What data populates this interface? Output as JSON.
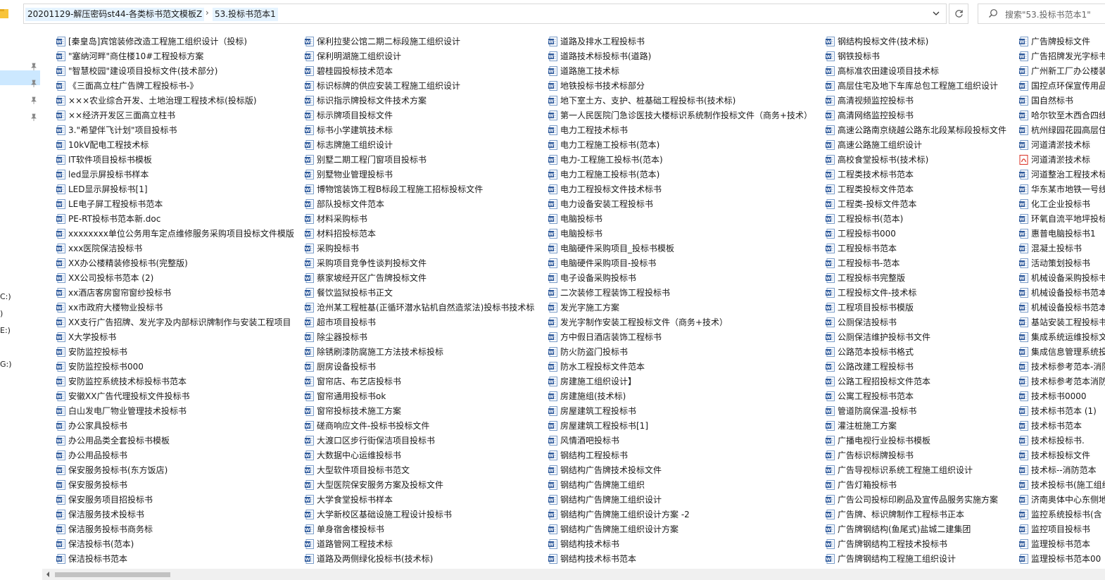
{
  "address": {
    "crumbs": [
      "20201129-解压密码st44-各类标书范文模板Z",
      "53.投标书范本1"
    ],
    "separator": "›"
  },
  "search": {
    "placeholder": "搜索\"53.投标书范本1\""
  },
  "nav": {
    "drives": [
      "C:)",
      ")",
      "E:)",
      "G:)"
    ]
  },
  "icons": {
    "folder": "folder-icon",
    "word": "word-doc-icon",
    "pdf": "pdf-icon",
    "pin": "pin-icon",
    "refresh": "refresh-icon",
    "search": "search-icon",
    "dropdown": "chevron-down-icon"
  },
  "colors": {
    "word": "#2b579a",
    "pdf": "#d93025",
    "selection": "#cce8ff",
    "crumb_bg": "#e5f3ff"
  },
  "files": [
    [
      "[秦皇岛]宾馆装修改造工程施工组织设计（投标)",
      "\"塞纳河畔\"商住楼10#工程投标方案",
      "\"智慧校园\"建设项目投标文件(技术部分)",
      "《三面高立柱广告牌工程投标书-》",
      "×××农业综合开发、土地治理工程技术标(投标版)",
      "××经济开发区三面高立柱书",
      "3.\"希望伴飞计划\"项目投标书",
      "10kV配电工程技术标",
      "IT软件项目投标书模板",
      "led显示屏投标书样本",
      "LED显示屏投标书[1]",
      "LE电子屏工程投标书范本",
      "PE-RT投标书范本新.doc",
      "xxxxxxxx单位公务用车定点维修服务采购项目投标文件模版",
      "xxx医院保洁投标书",
      "XX办公楼精装修投标书(完整版)",
      "XX公司投标书范本 (2)",
      "xx酒店客房窗帘窗纱投标书",
      "xx市政府大楼物业投标书",
      "XX支行广告招牌、发光字及内部标识牌制作与安装工程项目",
      "X大学投标书",
      "安防监控投标书",
      "安防监控投标书000",
      "安防监控系统技术标投标书范本",
      "安徽XX广告代理投标文件投标书",
      "白山发电厂物业管理技术投标书",
      "办公家具投标书",
      "办公用品类全套投标书模板",
      "办公用品投标书",
      "保安服务投标书(东方饭店)",
      "保安服务投标书",
      "保安服务项目招投标书",
      "保洁服务技术投标书",
      "保洁服务投标书商务标",
      "保洁投标书(范本)",
      "保洁投标书范本"
    ],
    [
      "保利拉斐公馆二期二标段施工组织设计",
      "保利明湖施工组织设计",
      "碧桂园投标技术范本",
      "标识标牌的供应安装工程施工组织设计",
      "标识指示牌投标文件技术方案",
      "标示牌项目投标文件",
      "标书小学建筑技术标",
      "标志牌施工组织设计",
      "别墅二期工程门窗项目投标书",
      "别墅物业管理投标书",
      "博物馆装饰工程B标段工程施工招标投标文件",
      "部队投标文件范本",
      "材料采购标书",
      "材料招投标范本",
      "采购投标书",
      "采购项目竞争性谈判投标文件",
      "蔡家坡经开区广告牌投标文件",
      "餐饮监狱投标书正文",
      "沧州某工程桩基(正循环潜水钻机自然造浆法)投标书技术标",
      "超市项目投标书",
      "除尘器投标书",
      "除锈刷漆防腐施工方法技术标投标",
      "厨房设备投标书",
      "窗帘店、布艺店投标书",
      "窗帘通用投标书ok",
      "窗帘投标技术施工方案",
      "磋商响应文件-投标书投标文件",
      "大渡口区步行街保洁项目投标书",
      "大数据中心运维投标书",
      "大型软件项目投标书范文",
      "大型医院保安服务方案及投标文件",
      "大学食堂投标书样本",
      "大学新校区基础设施工程设计投标书",
      "单身宿舍楼投标书",
      "道路管网工程技术标",
      "道路及两侧绿化投标书(技术标)"
    ],
    [
      "道路及排水工程投标书",
      "道路技术标投标书(道路)",
      "道路施工技术标",
      "地铁投标书技术标部分",
      "地下室土方、支护、桩基础工程投标书(技术标)",
      "第一人民医院门急诊医技大楼标识系统制作投标文件（商务+技术）",
      "电力工程技术标书",
      "电力工程施工投标书(范本)",
      "电力-工程施工投标书(范本)",
      "电力工程施工投标书(范本)",
      "电力工程投标文件技术标书",
      "电力设备安装工程投标书",
      "电脑投标书",
      "电脑投标书",
      "电脑硬件采购项目_投标书模板",
      "电脑硬件采购项目-投标书",
      "电子设备采购投标书",
      "二次装修工程装饰工程投标书",
      "发光字施工方案",
      "发光字制作安装工程投标文件（商务+技术）",
      "方中假日酒店装饰工程标书",
      "防火防盗门投标书",
      "防水工程投标文件范本",
      "房建施工组织设计】",
      "房建施组(技术标)",
      "房屋建筑工程投标书",
      "房屋建筑工程投标书[1]",
      "风情酒吧投标书",
      "钢结构工程投标书",
      "钢结构广告牌技术投标文件",
      "钢结构广告牌施工组织",
      "钢结构广告牌施工组织设计",
      "钢结构广告牌施工组织设计方案 -2",
      "钢结构广告牌施工组织设计方案",
      "钢结构技术标书",
      "钢结构技术标书范本"
    ],
    [
      "钢结构投标文件(技术标)",
      "钢铁投标书",
      "高标准农田建设项目技术标",
      "高层住宅及地下车库总包工程施工组织设计",
      "高清视频监控投标书",
      "高清网络监控投标书",
      "高速公路南京绕越公路东北段某标段投标文件",
      "高速公路施工组织设计",
      "高校食堂投标书(技术标)",
      "工程类技术标书范本",
      "工程类投标文件范本",
      "工程类-投标文件范本",
      "工程投标书(范本)",
      "工程投标书000",
      "工程投标书范本",
      "工程投标书-范本",
      "工程投标书完整版",
      "工程投标文件-技术标",
      "工程项目投标书模版",
      "公厕保洁投标书",
      "公厕保洁维护投标书文件",
      "公路范本投标书格式",
      "公路改建工程投标书",
      "公路工程招投标文件范本",
      "公寓工程投标书范本",
      "管道防腐保温-投标书",
      "灌注桩施工方案",
      "广播电视行业投标书模板",
      "广告标识标牌投标书",
      "广告导视标识系统工程施工组织设计",
      "广告灯箱投标书",
      "广告公司投标印刷品及宣传品服务实施方案",
      "广告牌、标识牌制作工程标书正本",
      "广告牌钢结构(鱼尾式)盐城二建集团",
      "广告牌钢结构工程技术投标书",
      "广告牌钢结构工程施工组织设计"
    ],
    [
      "广告牌投标文件",
      "广告招牌发光字标书",
      "广州新工厂办公楼装饰",
      "国控点环保宣传用品",
      "国自然标书",
      "哈尔钦至木西合四线",
      "杭州绿园花园高层住宅",
      "河道清淤技术标",
      "河道清淤技术标",
      "河道整治工程技术标",
      "华东某市地铁一号线",
      "化工企业投标书",
      "环氧自流平地坪投标",
      "惠普电脑投标书1",
      "混凝土投标书",
      "活动策划投标书",
      "机械设备采购投标书",
      "机械设备投标书范本",
      "机械设备投标书范本",
      "基站安装工程投标书",
      "集成系统运维投标文件",
      "集成信息管理系统投标",
      "技术标参考范本-消防",
      "技术标参考范本消防",
      "技术标书0000",
      "技术标书范本 (1)",
      "技术标书范本",
      "技术标投标书.",
      "技术标投标文件",
      "技术标--消防范本",
      "技术投标书(施工组织",
      "济南奥体中心东侧地块",
      "监控系统投标书(含",
      "监控项目投标书",
      "监理投标书范本",
      "监理投标书范本00"
    ]
  ],
  "pdf_files": [
    [
      4,
      8
    ]
  ]
}
